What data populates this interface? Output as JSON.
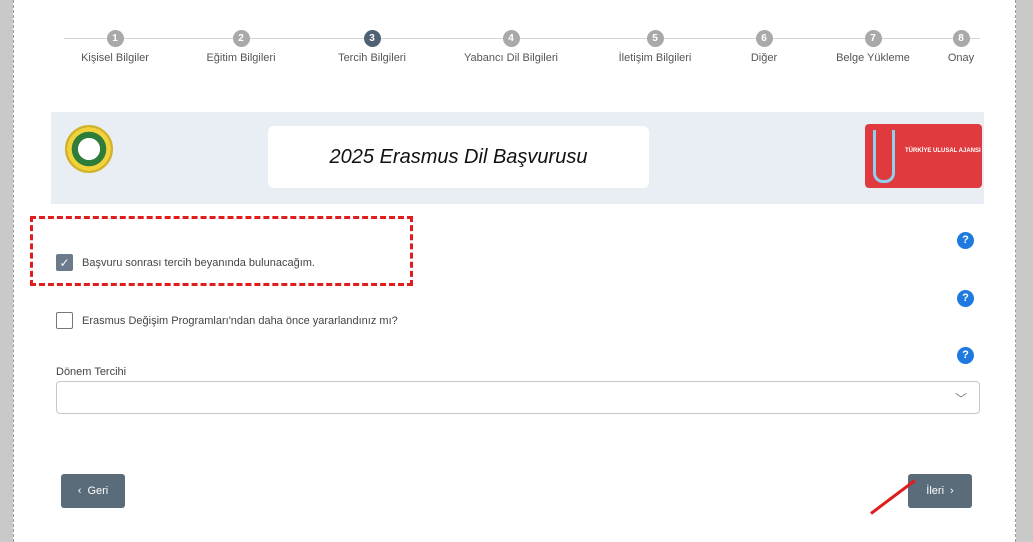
{
  "stepper": {
    "steps": [
      {
        "number": "1",
        "label": "Kişisel Bilgiler"
      },
      {
        "number": "2",
        "label": "Eğitim Bilgileri"
      },
      {
        "number": "3",
        "label": "Tercih Bilgileri"
      },
      {
        "number": "4",
        "label": "Yabancı Dil Bilgileri"
      },
      {
        "number": "5",
        "label": "İletişim Bilgileri"
      },
      {
        "number": "6",
        "label": "Diğer"
      },
      {
        "number": "7",
        "label": "Belge Yükleme"
      },
      {
        "number": "8",
        "label": "Onay"
      }
    ],
    "active_step": 3
  },
  "banner": {
    "title": "2025 Erasmus Dil Başvurusu",
    "right_logo_text": "TÜRKİYE ULUSAL AJANSI"
  },
  "form": {
    "preference_checkbox": {
      "label": "Başvuru sonrası tercih beyanında bulunacağım.",
      "checked": true
    },
    "erasmus_checkbox": {
      "label": "Erasmus Değişim Programları'ndan daha önce yararlandınız mı?",
      "checked": false
    },
    "semester_select": {
      "label": "Dönem Tercihi",
      "value": ""
    }
  },
  "help_icon_text": "?",
  "buttons": {
    "back_label": "Geri",
    "next_label": "İleri"
  },
  "colors": {
    "accent": "#5a6b7a",
    "help": "#1f7ae0",
    "highlight": "#e01c1c",
    "banner_bg": "#e8eef4"
  },
  "icons": {
    "back": "chevron-left-icon",
    "next": "chevron-right-icon",
    "dropdown": "chevron-down-icon",
    "check": "checkmark-icon"
  }
}
